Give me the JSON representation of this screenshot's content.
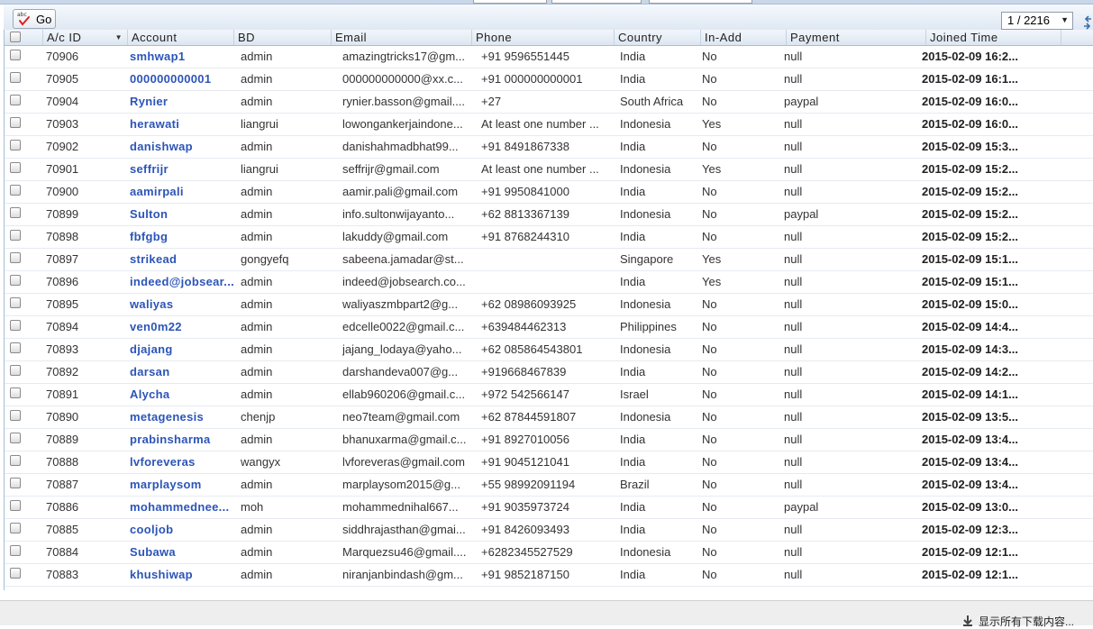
{
  "toolbar": {
    "go_label": "Go",
    "page_indicator": "1 / 2216"
  },
  "columns": {
    "id": "A/c ID",
    "account": "Account",
    "bd": "BD",
    "email": "Email",
    "phone": "Phone",
    "country": "Country",
    "inadd": "In-Add",
    "payment": "Payment",
    "joined": "Joined Time"
  },
  "rows": [
    {
      "id": "70906",
      "account": "smhwap1",
      "bd": "admin",
      "email": "amazingtricks17@gm...",
      "phone": "+91 9596551445",
      "country": "India",
      "inadd": "No",
      "payment": "null",
      "joined": "2015-02-09 16:2..."
    },
    {
      "id": "70905",
      "account": "000000000001",
      "bd": "admin",
      "email": "000000000000@xx.c...",
      "phone": "+91 000000000001",
      "country": "India",
      "inadd": "No",
      "payment": "null",
      "joined": "2015-02-09 16:1..."
    },
    {
      "id": "70904",
      "account": "Rynier",
      "bd": "admin",
      "email": "rynier.basson@gmail....",
      "phone": "+27",
      "country": "South Africa",
      "inadd": "No",
      "payment": "paypal",
      "joined": "2015-02-09 16:0..."
    },
    {
      "id": "70903",
      "account": "herawati",
      "bd": "liangrui",
      "email": "lowongankerjaindone...",
      "phone": "At least one number ...",
      "country": "Indonesia",
      "inadd": "Yes",
      "payment": "null",
      "joined": "2015-02-09 16:0..."
    },
    {
      "id": "70902",
      "account": "danishwap",
      "bd": "admin",
      "email": "danishahmadbhat99...",
      "phone": "+91 8491867338",
      "country": "India",
      "inadd": "No",
      "payment": "null",
      "joined": "2015-02-09 15:3..."
    },
    {
      "id": "70901",
      "account": "seffrijr",
      "bd": "liangrui",
      "email": "seffrijr@gmail.com",
      "phone": "At least one number ...",
      "country": "Indonesia",
      "inadd": "Yes",
      "payment": "null",
      "joined": "2015-02-09 15:2..."
    },
    {
      "id": "70900",
      "account": "aamirpali",
      "bd": "admin",
      "email": "aamir.pali@gmail.com",
      "phone": "+91 9950841000",
      "country": "India",
      "inadd": "No",
      "payment": "null",
      "joined": "2015-02-09 15:2..."
    },
    {
      "id": "70899",
      "account": "Sulton",
      "bd": "admin",
      "email": "info.sultonwijayanto...",
      "phone": "+62 8813367139",
      "country": "Indonesia",
      "inadd": "No",
      "payment": "paypal",
      "joined": "2015-02-09 15:2..."
    },
    {
      "id": "70898",
      "account": "fbfgbg",
      "bd": "admin",
      "email": "lakuddy@gmail.com",
      "phone": "+91 8768244310",
      "country": "India",
      "inadd": "No",
      "payment": "null",
      "joined": "2015-02-09 15:2..."
    },
    {
      "id": "70897",
      "account": "strikead",
      "bd": "gongyefq",
      "email": "sabeena.jamadar@st...",
      "phone": "",
      "country": "Singapore",
      "inadd": "Yes",
      "payment": "null",
      "joined": "2015-02-09 15:1..."
    },
    {
      "id": "70896",
      "account": "indeed@jobsear...",
      "bd": "admin",
      "email": "indeed@jobsearch.co...",
      "phone": "",
      "country": "India",
      "inadd": "Yes",
      "payment": "null",
      "joined": "2015-02-09 15:1..."
    },
    {
      "id": "70895",
      "account": "waliyas",
      "bd": "admin",
      "email": "waliyaszmbpart2@g...",
      "phone": "+62 08986093925",
      "country": "Indonesia",
      "inadd": "No",
      "payment": "null",
      "joined": "2015-02-09 15:0..."
    },
    {
      "id": "70894",
      "account": "ven0m22",
      "bd": "admin",
      "email": "edcelle0022@gmail.c...",
      "phone": "+639484462313",
      "country": "Philippines",
      "inadd": "No",
      "payment": "null",
      "joined": "2015-02-09 14:4..."
    },
    {
      "id": "70893",
      "account": "djajang",
      "bd": "admin",
      "email": "jajang_lodaya@yaho...",
      "phone": "+62 085864543801",
      "country": "Indonesia",
      "inadd": "No",
      "payment": "null",
      "joined": "2015-02-09 14:3..."
    },
    {
      "id": "70892",
      "account": "darsan",
      "bd": "admin",
      "email": "darshandeva007@g...",
      "phone": "+919668467839",
      "country": "India",
      "inadd": "No",
      "payment": "null",
      "joined": "2015-02-09 14:2..."
    },
    {
      "id": "70891",
      "account": "Alycha",
      "bd": "admin",
      "email": "ellab960206@gmail.c...",
      "phone": "+972 542566147",
      "country": "Israel",
      "inadd": "No",
      "payment": "null",
      "joined": "2015-02-09 14:1..."
    },
    {
      "id": "70890",
      "account": "metagenesis",
      "bd": "chenjp",
      "email": "neo7team@gmail.com",
      "phone": "+62 87844591807",
      "country": "Indonesia",
      "inadd": "No",
      "payment": "null",
      "joined": "2015-02-09 13:5..."
    },
    {
      "id": "70889",
      "account": "prabinsharma",
      "bd": "admin",
      "email": "bhanuxarma@gmail.c...",
      "phone": "+91 8927010056",
      "country": "India",
      "inadd": "No",
      "payment": "null",
      "joined": "2015-02-09 13:4..."
    },
    {
      "id": "70888",
      "account": "lvforeveras",
      "bd": "wangyx",
      "email": "lvforeveras@gmail.com",
      "phone": "+91 9045121041",
      "country": "India",
      "inadd": "No",
      "payment": "null",
      "joined": "2015-02-09 13:4..."
    },
    {
      "id": "70887",
      "account": "marplaysom",
      "bd": "admin",
      "email": "marplaysom2015@g...",
      "phone": "+55 98992091194",
      "country": "Brazil",
      "inadd": "No",
      "payment": "null",
      "joined": "2015-02-09 13:4..."
    },
    {
      "id": "70886",
      "account": "mohammednee...",
      "bd": "moh",
      "email": "mohammednihal667...",
      "phone": "+91 9035973724",
      "country": "India",
      "inadd": "No",
      "payment": "paypal",
      "joined": "2015-02-09 13:0..."
    },
    {
      "id": "70885",
      "account": "cooljob",
      "bd": "admin",
      "email": "siddhrajasthan@gmai...",
      "phone": "+91 8426093493",
      "country": "India",
      "inadd": "No",
      "payment": "null",
      "joined": "2015-02-09 12:3..."
    },
    {
      "id": "70884",
      "account": "Subawa",
      "bd": "admin",
      "email": "Marquezsu46@gmail....",
      "phone": "+6282345527529",
      "country": "Indonesia",
      "inadd": "No",
      "payment": "null",
      "joined": "2015-02-09 12:1..."
    },
    {
      "id": "70883",
      "account": "khushiwap",
      "bd": "admin",
      "email": "niranjanbindash@gm...",
      "phone": "+91 9852187150",
      "country": "India",
      "inadd": "No",
      "payment": "null",
      "joined": "2015-02-09 12:1..."
    }
  ],
  "footer": {
    "download_all": "显示所有下载内容..."
  }
}
